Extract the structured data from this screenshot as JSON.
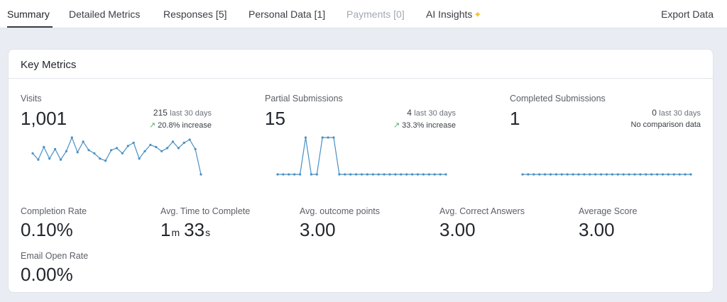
{
  "tabs": [
    {
      "label": "Summary",
      "state": "active"
    },
    {
      "label": "Detailed Metrics",
      "state": "normal"
    },
    {
      "label": "Responses [5]",
      "state": "normal"
    },
    {
      "label": "Personal Data [1]",
      "state": "normal"
    },
    {
      "label": "Payments [0]",
      "state": "disabled"
    },
    {
      "label": "AI Insights",
      "state": "normal",
      "icon": "sparkle-icon"
    }
  ],
  "export_label": "Export Data",
  "card": {
    "title": "Key Metrics",
    "top_metrics": [
      {
        "label": "Visits",
        "value": "1,001",
        "recent_count": "215",
        "recent_label": "last 30 days",
        "change": "20.8% increase",
        "trend_icon": "trending-up-icon",
        "series": [
          60,
          54,
          66,
          55,
          64,
          54,
          62,
          75,
          61,
          71,
          63,
          60,
          55,
          53,
          63,
          65,
          60,
          67,
          70,
          55,
          62,
          68,
          66,
          62,
          65,
          71,
          65,
          70,
          73,
          64,
          40
        ]
      },
      {
        "label": "Partial Submissions",
        "value": "15",
        "recent_count": "4",
        "recent_label": "last 30 days",
        "change": "33.3% increase",
        "trend_icon": "trending-up-icon",
        "series": [
          0,
          0,
          0,
          0,
          0,
          2,
          0,
          0,
          2,
          2,
          2,
          0,
          0,
          0,
          0,
          0,
          0,
          0,
          0,
          0,
          0,
          0,
          0,
          0,
          0,
          0,
          0,
          0,
          0,
          0,
          0
        ]
      },
      {
        "label": "Completed Submissions",
        "value": "1",
        "recent_count": "0",
        "recent_label": "last 30 days",
        "change": "No comparison data",
        "trend_icon": "",
        "series": [
          0,
          0,
          0,
          0,
          0,
          0,
          0,
          0,
          0,
          0,
          0,
          0,
          0,
          0,
          0,
          0,
          0,
          0,
          0,
          0,
          0,
          0,
          0,
          0,
          0,
          0,
          0,
          0,
          0,
          0,
          0
        ]
      }
    ],
    "secondary_metrics": [
      {
        "label": "Completion Rate",
        "value": "0.10%"
      },
      {
        "label": "Avg. Time to Complete",
        "min_value": "1",
        "min_unit": "m",
        "sec_value": "33",
        "sec_unit": "s"
      },
      {
        "label": "Avg. outcome points",
        "value": "3.00"
      },
      {
        "label": "Avg. Correct Answers",
        "value": "3.00"
      },
      {
        "label": "Average Score",
        "value": "3.00"
      },
      {
        "label": "Email Open Rate",
        "value": "0.00%"
      }
    ]
  },
  "colors": {
    "accent": "#4a90c2",
    "trend_up": "#4caf6a"
  }
}
